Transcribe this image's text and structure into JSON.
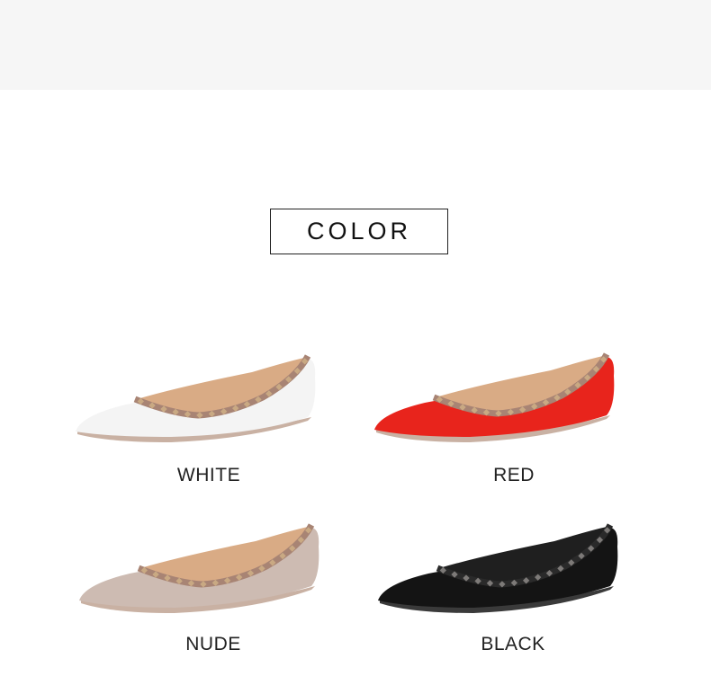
{
  "section": {
    "title": "COLOR"
  },
  "variants": [
    {
      "label": "WHITE",
      "body_color": "#f4f4f4",
      "trim_color": "#a88474",
      "lining_color": "#d9ab85",
      "stud_color": "#c9a983"
    },
    {
      "label": "RED",
      "body_color": "#e8241c",
      "trim_color": "#a88474",
      "lining_color": "#d9ab85",
      "stud_color": "#c9a983"
    },
    {
      "label": "NUDE",
      "body_color": "#cdbbb2",
      "trim_color": "#a88474",
      "lining_color": "#d9ab85",
      "stud_color": "#c9a983"
    },
    {
      "label": "BLACK",
      "body_color": "#141414",
      "trim_color": "#2a2a2a",
      "lining_color": "#1f1f1f",
      "stud_color": "#7d7a78"
    }
  ]
}
